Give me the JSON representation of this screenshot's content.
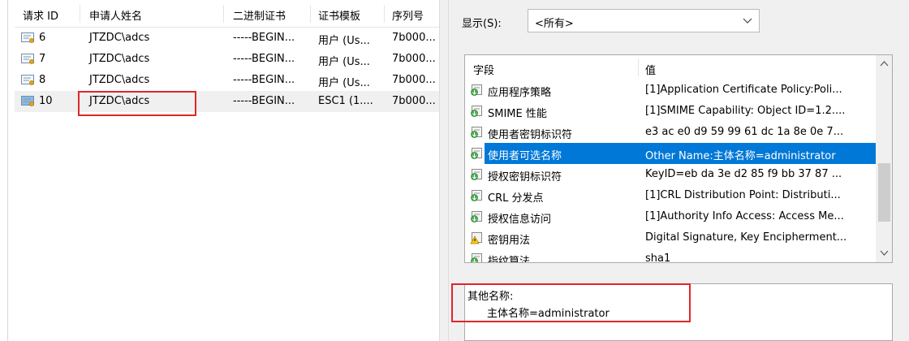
{
  "requests": {
    "columns": [
      "请求 ID",
      "申请人姓名",
      "二进制证书",
      "证书模板",
      "序列号"
    ],
    "rows": [
      {
        "id": "6",
        "requester": "JTZDC\\adcs",
        "binary": "-----BEGIN...",
        "template": "用户 (Us...",
        "serial": "7b000...",
        "selected": false
      },
      {
        "id": "7",
        "requester": "JTZDC\\adcs",
        "binary": "-----BEGIN...",
        "template": "用户 (Us...",
        "serial": "7b000...",
        "selected": false
      },
      {
        "id": "8",
        "requester": "JTZDC\\adcs",
        "binary": "-----BEGIN...",
        "template": "用户 (Us...",
        "serial": "7b000...",
        "selected": false
      },
      {
        "id": "10",
        "requester": "JTZDC\\adcs",
        "binary": "-----BEGIN...",
        "template": "ESC1 (1....",
        "serial": "7b000...",
        "selected": true
      }
    ]
  },
  "details": {
    "show_label": "显示(S):",
    "show_value": "<所有>",
    "columns": [
      "字段",
      "值"
    ],
    "fields": [
      {
        "name": "应用程序策略",
        "value": "[1]Application Certificate Policy:Poli...",
        "icon": "extension-icon",
        "selected": false
      },
      {
        "name": "SMIME 性能",
        "value": "[1]SMIME Capability: Object ID=1.2....",
        "icon": "extension-icon",
        "selected": false
      },
      {
        "name": "使用者密钥标识符",
        "value": "e3 ac e0 d9 59 99 61 dc 1a 8e 0e 7...",
        "icon": "extension-icon",
        "selected": false
      },
      {
        "name": "使用者可选名称",
        "value": "Other Name:主体名称=administrator",
        "icon": "extension-icon",
        "selected": true
      },
      {
        "name": "授权密钥标识符",
        "value": "KeyID=eb da 3e d2 85 f9 bb 37 87 ...",
        "icon": "extension-icon",
        "selected": false
      },
      {
        "name": "CRL 分发点",
        "value": "[1]CRL Distribution Point: Distributi...",
        "icon": "extension-icon",
        "selected": false
      },
      {
        "name": "授权信息访问",
        "value": "[1]Authority Info Access: Access Me...",
        "icon": "extension-icon",
        "selected": false
      },
      {
        "name": "密钥用法",
        "value": "Digital Signature, Key Encipherment...",
        "icon": "warning-extension-icon",
        "selected": false
      },
      {
        "name": "指纹算法",
        "value": "sha1",
        "icon": "extension-icon",
        "selected": false
      }
    ],
    "detail_text": {
      "line1": "其他名称:",
      "line2": "主体名称=administrator"
    }
  },
  "colors": {
    "selection": "#0078d7",
    "annotation": "#e0262a"
  }
}
